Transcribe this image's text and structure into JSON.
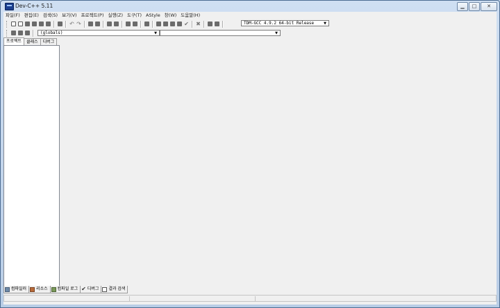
{
  "window": {
    "title": "Dev-C++ 5.11"
  },
  "menu": [
    "파일(F)",
    "편집(E)",
    "검색(S)",
    "보기(V)",
    "프로젝트(P)",
    "실행(Z)",
    "도구(T)",
    "AStyle",
    "창(W)",
    "도움말(H)"
  ],
  "compiler_select": {
    "value": "TDM-GCC 4.9.2 64-bit Release"
  },
  "class_combo": {
    "value": "(globals)"
  },
  "member_combo": {
    "value": ""
  },
  "left_tabs": [
    "프로젝트",
    "클래스",
    "디버그"
  ],
  "bottom_tabs": [
    {
      "label": "컴파일러",
      "icon": "compiler-grid-icon"
    },
    {
      "label": "리소스",
      "icon": "resources-icon"
    },
    {
      "label": "컴파일 로그",
      "icon": "compile-log-icon"
    },
    {
      "label": "디버그",
      "icon": "debug-check-icon"
    },
    {
      "label": "결과 검색",
      "icon": "find-results-icon"
    }
  ],
  "colors": {
    "window_frame": "#c9d9ec",
    "client": "#f0f0f0",
    "icon_gray": "#6b6b6b"
  }
}
